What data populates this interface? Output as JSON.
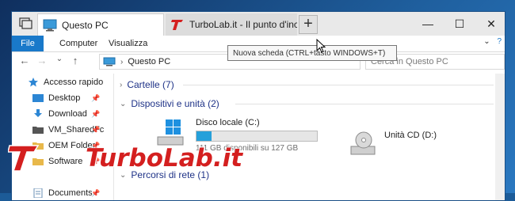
{
  "tabs": [
    {
      "label": "Questo PC",
      "icon": "computer-icon",
      "active": true
    },
    {
      "label": "TurboLab.it - Il punto d'inc",
      "icon": "turbolab-logo-icon",
      "active": false
    }
  ],
  "new_tab_symbol": "+",
  "window_controls": {
    "minimize": "—",
    "maximize": "☐",
    "close": "✕"
  },
  "ribbon": {
    "file": "File",
    "computer": "Computer",
    "view": "Visualizza",
    "expand_icon": "chevron-down-icon",
    "help_icon": "help-icon"
  },
  "tooltip": "Nuova scheda (CTRL+tasto WINDOWS+T)",
  "nav": {
    "back": "←",
    "forward": "→",
    "recent": "⌄",
    "up": "↑"
  },
  "address": {
    "path": "Questo PC",
    "dropdown": "⌄",
    "refresh": "⟳"
  },
  "search": {
    "placeholder": "Cerca in Questo PC"
  },
  "sidebar": {
    "items": [
      {
        "label": "Accesso rapido",
        "icon": "star-icon",
        "pinned": false
      },
      {
        "label": "Desktop",
        "icon": "desktop-icon",
        "pinned": true
      },
      {
        "label": "Download",
        "icon": "download-icon",
        "pinned": true
      },
      {
        "label": "VM_SharedFc",
        "icon": "folder-icon",
        "pinned": true
      },
      {
        "label": "OEM Folder",
        "icon": "folder-icon",
        "pinned": true
      },
      {
        "label": "Software",
        "icon": "folder-icon",
        "pinned": true
      },
      {
        "label": "Documents",
        "icon": "documents-icon",
        "pinned": true
      }
    ],
    "pin_symbol": "📌"
  },
  "groups": {
    "folders": "Cartelle (7)",
    "devices": "Dispositivi e unità (2)",
    "network": "Percorsi di rete (1)"
  },
  "drives": [
    {
      "name": "Disco locale (C:)",
      "free": "111 GB disponibili su 127 GB",
      "used_fraction": 0.126,
      "icon": "windows-drive-icon"
    },
    {
      "name": "Unità CD (D:)",
      "icon": "cd-drive-icon"
    }
  ],
  "watermark": {
    "text": "TurboLab.it",
    "icon": "turbolab-logo-icon"
  },
  "colors": {
    "accent": "#1979ca",
    "group_title": "#1e3287",
    "bar_fill": "#26a0da",
    "watermark_red": "#d41f1f"
  }
}
